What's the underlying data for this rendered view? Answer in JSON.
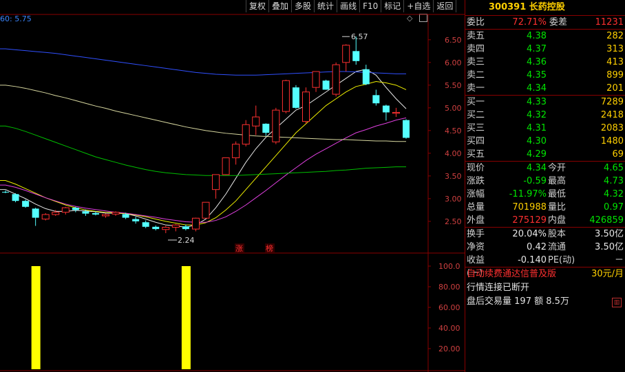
{
  "toolbar": {
    "buttons": [
      "复权",
      "叠加",
      "多股",
      "统计",
      "画线",
      "F10",
      "标记",
      "+自选",
      "返回"
    ]
  },
  "chart": {
    "ma_label": "60: 5.75",
    "y_ticks": [
      "6.50",
      "6.00",
      "5.50",
      "5.00",
      "4.50",
      "4.00",
      "3.50",
      "3.00",
      "2.50"
    ],
    "high_label": "6.57",
    "low_label": "2.24",
    "marks": [
      "涨",
      "榜"
    ],
    "sub_ticks": [
      "100.0",
      "80.00",
      "60.00",
      "40.00",
      "20.00"
    ],
    "colors": {
      "up": "#ff3030",
      "down": "#54ffff",
      "ma_white": "#e8e8e8",
      "ma_yellow": "#f0f000",
      "ma_magenta": "#e040e0",
      "ma_green": "#00c000",
      "ma_blue": "#3050ff",
      "ma_grey": "#d8d8a0"
    }
  },
  "chart_data": {
    "type": "candlestick",
    "ylim": [
      2.15,
      6.8
    ],
    "candles": [
      [
        3.15,
        3.18,
        3.12,
        3.14
      ],
      [
        3.1,
        3.12,
        2.92,
        2.95
      ],
      [
        2.95,
        2.98,
        2.8,
        2.82
      ],
      [
        2.78,
        2.8,
        2.4,
        2.58
      ],
      [
        2.55,
        2.68,
        2.52,
        2.65
      ],
      [
        2.65,
        2.75,
        2.62,
        2.7
      ],
      [
        2.7,
        2.82,
        2.65,
        2.8
      ],
      [
        2.8,
        2.82,
        2.7,
        2.75
      ],
      [
        2.72,
        2.76,
        2.62,
        2.67
      ],
      [
        2.68,
        2.72,
        2.63,
        2.65
      ],
      [
        2.62,
        2.67,
        2.58,
        2.65
      ],
      [
        2.66,
        2.72,
        2.62,
        2.7
      ],
      [
        2.66,
        2.69,
        2.55,
        2.58
      ],
      [
        2.55,
        2.6,
        2.45,
        2.5
      ],
      [
        2.48,
        2.52,
        2.35,
        2.38
      ],
      [
        2.38,
        2.41,
        2.3,
        2.33
      ],
      [
        2.32,
        2.4,
        2.24,
        2.37
      ],
      [
        2.37,
        2.44,
        2.28,
        2.42
      ],
      [
        2.39,
        2.43,
        2.3,
        2.33
      ],
      [
        2.33,
        2.58,
        2.28,
        2.57
      ],
      [
        2.57,
        2.92,
        2.56,
        2.92
      ],
      [
        3.2,
        3.53,
        3.0,
        3.53
      ],
      [
        3.53,
        3.9,
        3.52,
        3.9
      ],
      [
        3.9,
        4.26,
        3.75,
        4.2
      ],
      [
        4.2,
        4.73,
        4.15,
        4.63
      ],
      [
        4.6,
        5.05,
        4.4,
        4.8
      ],
      [
        4.65,
        4.66,
        4.38,
        4.45
      ],
      [
        4.25,
        5.0,
        4.2,
        4.95
      ],
      [
        4.92,
        5.62,
        4.88,
        5.6
      ],
      [
        5.45,
        5.5,
        4.98,
        5.0
      ],
      [
        4.7,
        5.45,
        4.65,
        5.35
      ],
      [
        5.45,
        5.8,
        5.35,
        5.8
      ],
      [
        5.6,
        5.62,
        5.4,
        5.4
      ],
      [
        5.3,
        6.0,
        5.25,
        5.95
      ],
      [
        6.0,
        6.4,
        5.8,
        6.38
      ],
      [
        6.25,
        6.57,
        5.95,
        6.03
      ],
      [
        5.85,
        5.95,
        5.5,
        5.52
      ],
      [
        5.28,
        5.4,
        5.05,
        5.1
      ],
      [
        5.05,
        5.07,
        4.72,
        4.9
      ],
      [
        4.88,
        5.0,
        4.8,
        4.9
      ],
      [
        4.73,
        4.75,
        4.32,
        4.34
      ]
    ],
    "ma_series": [
      {
        "color": "ma_white",
        "values": [
          3.2,
          3.1,
          3.0,
          2.88,
          2.78,
          2.72,
          2.72,
          2.74,
          2.73,
          2.71,
          2.68,
          2.68,
          2.67,
          2.62,
          2.55,
          2.48,
          2.42,
          2.4,
          2.37,
          2.42,
          2.55,
          2.8,
          3.1,
          3.45,
          3.8,
          4.1,
          4.35,
          4.55,
          4.75,
          4.95,
          5.05,
          5.2,
          5.35,
          5.5,
          5.65,
          5.8,
          5.85,
          5.72,
          5.45,
          5.2,
          4.98
        ]
      },
      {
        "color": "ma_yellow",
        "values": [
          3.4,
          3.32,
          3.22,
          3.12,
          3.02,
          2.94,
          2.86,
          2.8,
          2.75,
          2.72,
          2.7,
          2.69,
          2.67,
          2.64,
          2.6,
          2.55,
          2.5,
          2.46,
          2.42,
          2.42,
          2.47,
          2.58,
          2.75,
          2.95,
          3.2,
          3.45,
          3.7,
          3.95,
          4.2,
          4.45,
          4.65,
          4.85,
          5.05,
          5.2,
          5.35,
          5.47,
          5.52,
          5.58,
          5.55,
          5.5,
          5.4
        ]
      },
      {
        "color": "ma_magenta",
        "values": [
          3.3,
          3.25,
          3.18,
          3.1,
          3.02,
          2.95,
          2.88,
          2.83,
          2.79,
          2.76,
          2.73,
          2.7,
          2.68,
          2.65,
          2.62,
          2.59,
          2.55,
          2.52,
          2.49,
          2.48,
          2.48,
          2.52,
          2.6,
          2.72,
          2.86,
          3.02,
          3.18,
          3.35,
          3.52,
          3.68,
          3.84,
          3.98,
          4.1,
          4.22,
          4.34,
          4.45,
          4.52,
          4.6,
          4.66,
          4.73,
          4.78
        ]
      },
      {
        "color": "ma_grey",
        "values": [
          5.5,
          5.47,
          5.43,
          5.38,
          5.33,
          5.27,
          5.22,
          5.16,
          5.1,
          5.04,
          4.99,
          4.93,
          4.88,
          4.83,
          4.78,
          4.73,
          4.68,
          4.63,
          4.58,
          4.54,
          4.5,
          4.47,
          4.44,
          4.42,
          4.4,
          4.38,
          4.37,
          4.36,
          4.35,
          4.34,
          4.33,
          4.32,
          4.31,
          4.3,
          4.3,
          4.29,
          4.28,
          4.27,
          4.27,
          4.26,
          4.26
        ]
      },
      {
        "color": "ma_green",
        "values": [
          4.6,
          4.55,
          4.48,
          4.4,
          4.32,
          4.24,
          4.16,
          4.08,
          4.0,
          3.92,
          3.86,
          3.8,
          3.74,
          3.69,
          3.64,
          3.6,
          3.57,
          3.55,
          3.53,
          3.52,
          3.51,
          3.51,
          3.51,
          3.51,
          3.52,
          3.53,
          3.54,
          3.55,
          3.56,
          3.57,
          3.58,
          3.59,
          3.6,
          3.62,
          3.63,
          3.65,
          3.67,
          3.68,
          3.69,
          3.7,
          3.7
        ]
      },
      {
        "color": "ma_blue",
        "values": [
          6.3,
          6.28,
          6.26,
          6.24,
          6.22,
          6.2,
          6.17,
          6.14,
          6.11,
          6.08,
          6.05,
          6.02,
          5.99,
          5.96,
          5.93,
          5.9,
          5.87,
          5.84,
          5.81,
          5.78,
          5.76,
          5.74,
          5.73,
          5.72,
          5.72,
          5.72,
          5.73,
          5.74,
          5.75,
          5.76,
          5.77,
          5.78,
          5.79,
          5.8,
          5.8,
          5.79,
          5.78,
          5.77,
          5.76,
          5.75,
          5.75
        ]
      }
    ],
    "sub_ylim": [
      0,
      110
    ],
    "sub_bars": [
      {
        "index": 3,
        "value": 100
      },
      {
        "index": 18,
        "value": 100
      }
    ]
  },
  "panel": {
    "title": "300391 长药控股",
    "wb_label": "委比",
    "wb_value": "72.71%",
    "wc_label": "委差",
    "wc_value": "11231",
    "sells": [
      {
        "label": "卖五",
        "price": "4.38",
        "vol": "282"
      },
      {
        "label": "卖四",
        "price": "4.37",
        "vol": "313"
      },
      {
        "label": "卖三",
        "price": "4.36",
        "vol": "413"
      },
      {
        "label": "卖二",
        "price": "4.35",
        "vol": "899"
      },
      {
        "label": "卖一",
        "price": "4.34",
        "vol": "201"
      }
    ],
    "buys": [
      {
        "label": "买一",
        "price": "4.33",
        "vol": "7289"
      },
      {
        "label": "买二",
        "price": "4.32",
        "vol": "2418"
      },
      {
        "label": "买三",
        "price": "4.31",
        "vol": "2083"
      },
      {
        "label": "买四",
        "price": "4.30",
        "vol": "1480"
      },
      {
        "label": "买五",
        "price": "4.29",
        "vol": "69"
      }
    ],
    "quote": [
      {
        "l1": "现价",
        "v1": "4.34",
        "c1": "green",
        "l2": "今开",
        "v2": "4.65",
        "c2": "green"
      },
      {
        "l1": "涨跌",
        "v1": "-0.59",
        "c1": "green",
        "l2": "最高",
        "v2": "4.73",
        "c2": "green"
      },
      {
        "l1": "涨幅",
        "v1": "-11.97%",
        "c1": "green",
        "l2": "最低",
        "v2": "4.32",
        "c2": "green"
      },
      {
        "l1": "总量",
        "v1": "701988",
        "c1": "yellow",
        "l2": "量比",
        "v2": "0.97",
        "c2": "green"
      },
      {
        "l1": "外盘",
        "v1": "275129",
        "c1": "red",
        "l2": "内盘",
        "v2": "426859",
        "c2": "green"
      }
    ],
    "stats": [
      {
        "l1": "换手",
        "v1": "20.04%",
        "c1": "white",
        "l2": "股本",
        "v2": "3.50亿",
        "c2": "white"
      },
      {
        "l1": "净资",
        "v1": "0.42",
        "c1": "white",
        "l2": "流通",
        "v2": "3.50亿",
        "c2": "white"
      },
      {
        "l1": "收益(一)",
        "v1": "-0.140",
        "c1": "white",
        "l2": "PE(动)",
        "v2": "－",
        "c2": "white"
      }
    ],
    "ad_text": "自动续费通达信普及版",
    "ad_price": "30元/月",
    "conn_text": "行情连接已断开",
    "after_label": "盘后交易量",
    "after_vol": "197",
    "after_amt_label": "额",
    "after_amt": "8.5万"
  }
}
